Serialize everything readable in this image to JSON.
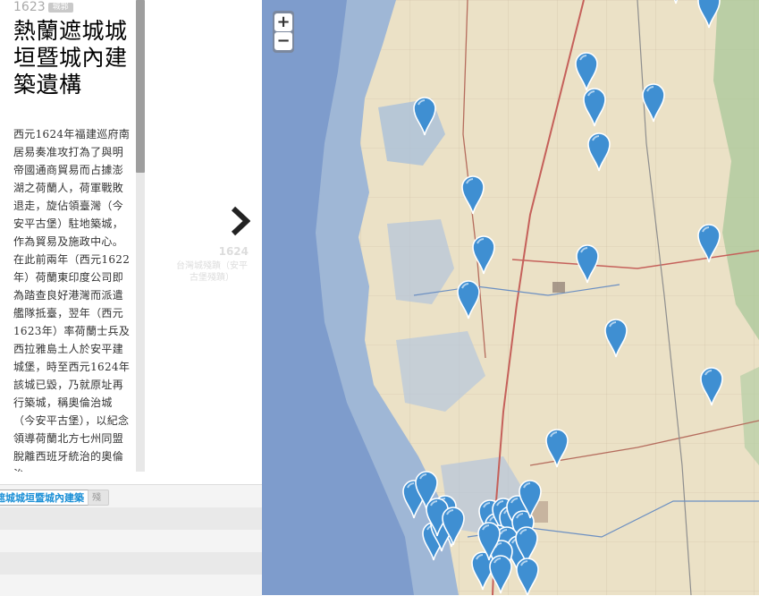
{
  "slide": {
    "year": "1623",
    "tag": "城郭",
    "title": "熱蘭遮城城垣暨城內建築遺構",
    "body": "西元1624年福建巡府南居易奏准攻打為了與明帝國通商貿易而占據澎湖之荷蘭人，荷軍戰敗退走，旋佔領臺灣（今安平古堡）駐地築城，作為貿易及施政中心。在此前兩年（西元1622年）荷蘭東印度公司即為踏查良好港灣而派遣艦隊抵臺，翌年（西元1623年）率荷蘭士兵及西拉雅島土人於安平建城堡，時至西元1624年該城已毀，乃就原址再行築城，稱奧倫治城（今安平古堡），以紀念領導荷蘭北方七州同盟脫離西班牙統治的奧倫治"
  },
  "next": {
    "year": "1624",
    "title": "台灣城殘蹟（安平古堡殘蹟）"
  },
  "timeline": {
    "marker_label": "遮城城垣暨城內建築",
    "marker2_label": "殘"
  },
  "map": {
    "zoom_in": "+",
    "zoom_out": "−",
    "pin_color": "#3f8fd2"
  }
}
